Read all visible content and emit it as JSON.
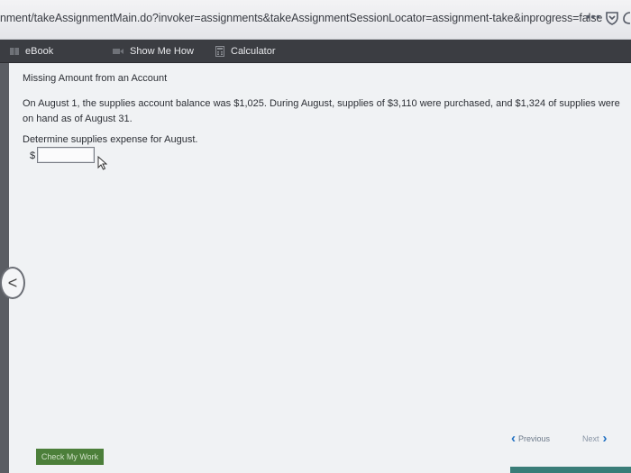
{
  "browser": {
    "url": "nment/takeAssignmentMain.do?invoker=assignments&takeAssignmentSessionLocator=assignment-take&inprogress=false",
    "menu_dots": "•••"
  },
  "toolbar": {
    "ebook_label": "eBook",
    "show_me_how_label": "Show Me How",
    "calculator_label": "Calculator"
  },
  "problem": {
    "title": "Missing Amount from an Account",
    "text": "On August 1, the supplies account balance was $1,025. During August, supplies of $3,110 were purchased, and $1,324 of supplies were on hand as of August 31.",
    "question": "Determine supplies expense for August.",
    "currency_symbol": "$",
    "answer_value": ""
  },
  "navigation": {
    "previous_label": "Previous",
    "next_label": "Next",
    "left_arrow": "<"
  },
  "actions": {
    "check_my_work_label": "Check My Work"
  },
  "colors": {
    "toolbar_bg": "#3b3d42",
    "accent_blue": "#1e6fc2",
    "check_button_green": "#4c7f3a"
  }
}
